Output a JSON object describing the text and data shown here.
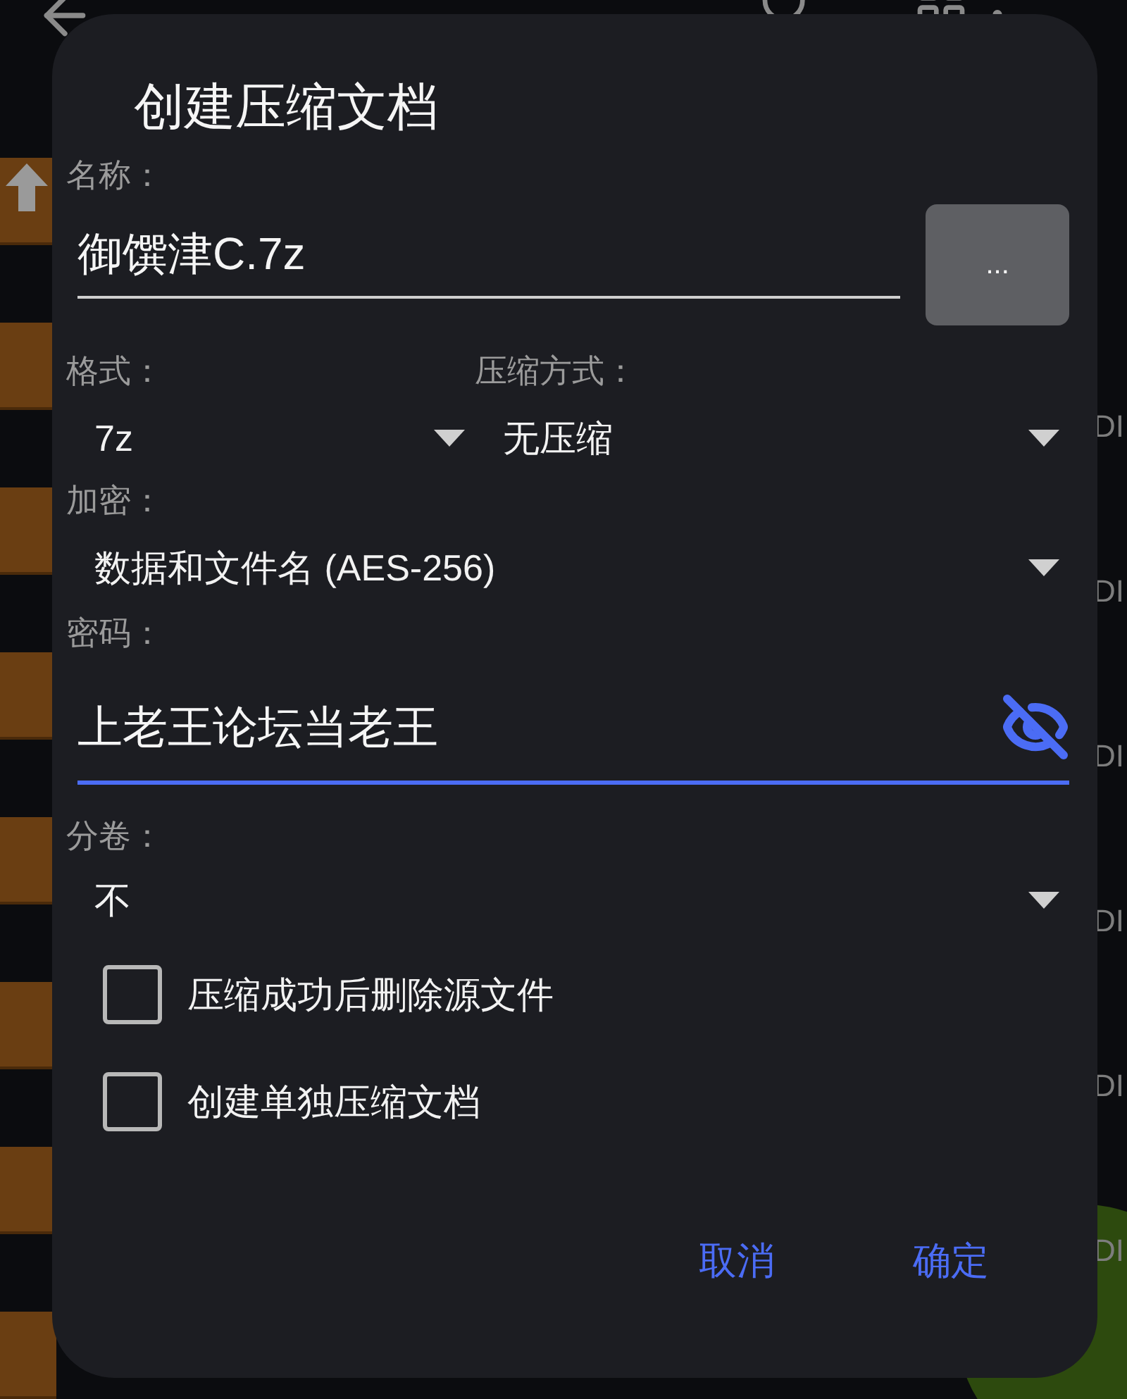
{
  "background_app": {
    "side_texts": [
      "DI",
      "DI",
      "DI",
      "DI",
      "DI",
      "DI"
    ]
  },
  "dialog": {
    "title": "创建压缩文档",
    "name": {
      "label": "名称：",
      "value": "御馔津C.7z",
      "browse_button": "..."
    },
    "format": {
      "label": "格式：",
      "value": "7z"
    },
    "method": {
      "label": "压缩方式：",
      "value": "无压缩"
    },
    "encryption": {
      "label": "加密：",
      "value": "数据和文件名 (AES-256)"
    },
    "password": {
      "label": "密码：",
      "value": "上老王论坛当老王",
      "focused": true,
      "visible": true
    },
    "split": {
      "label": "分卷：",
      "value": "不"
    },
    "options": [
      {
        "label": "压缩成功后删除源文件",
        "checked": false
      },
      {
        "label": "创建单独压缩文档",
        "checked": false
      }
    ],
    "buttons": [
      "取消",
      "确定"
    ]
  }
}
